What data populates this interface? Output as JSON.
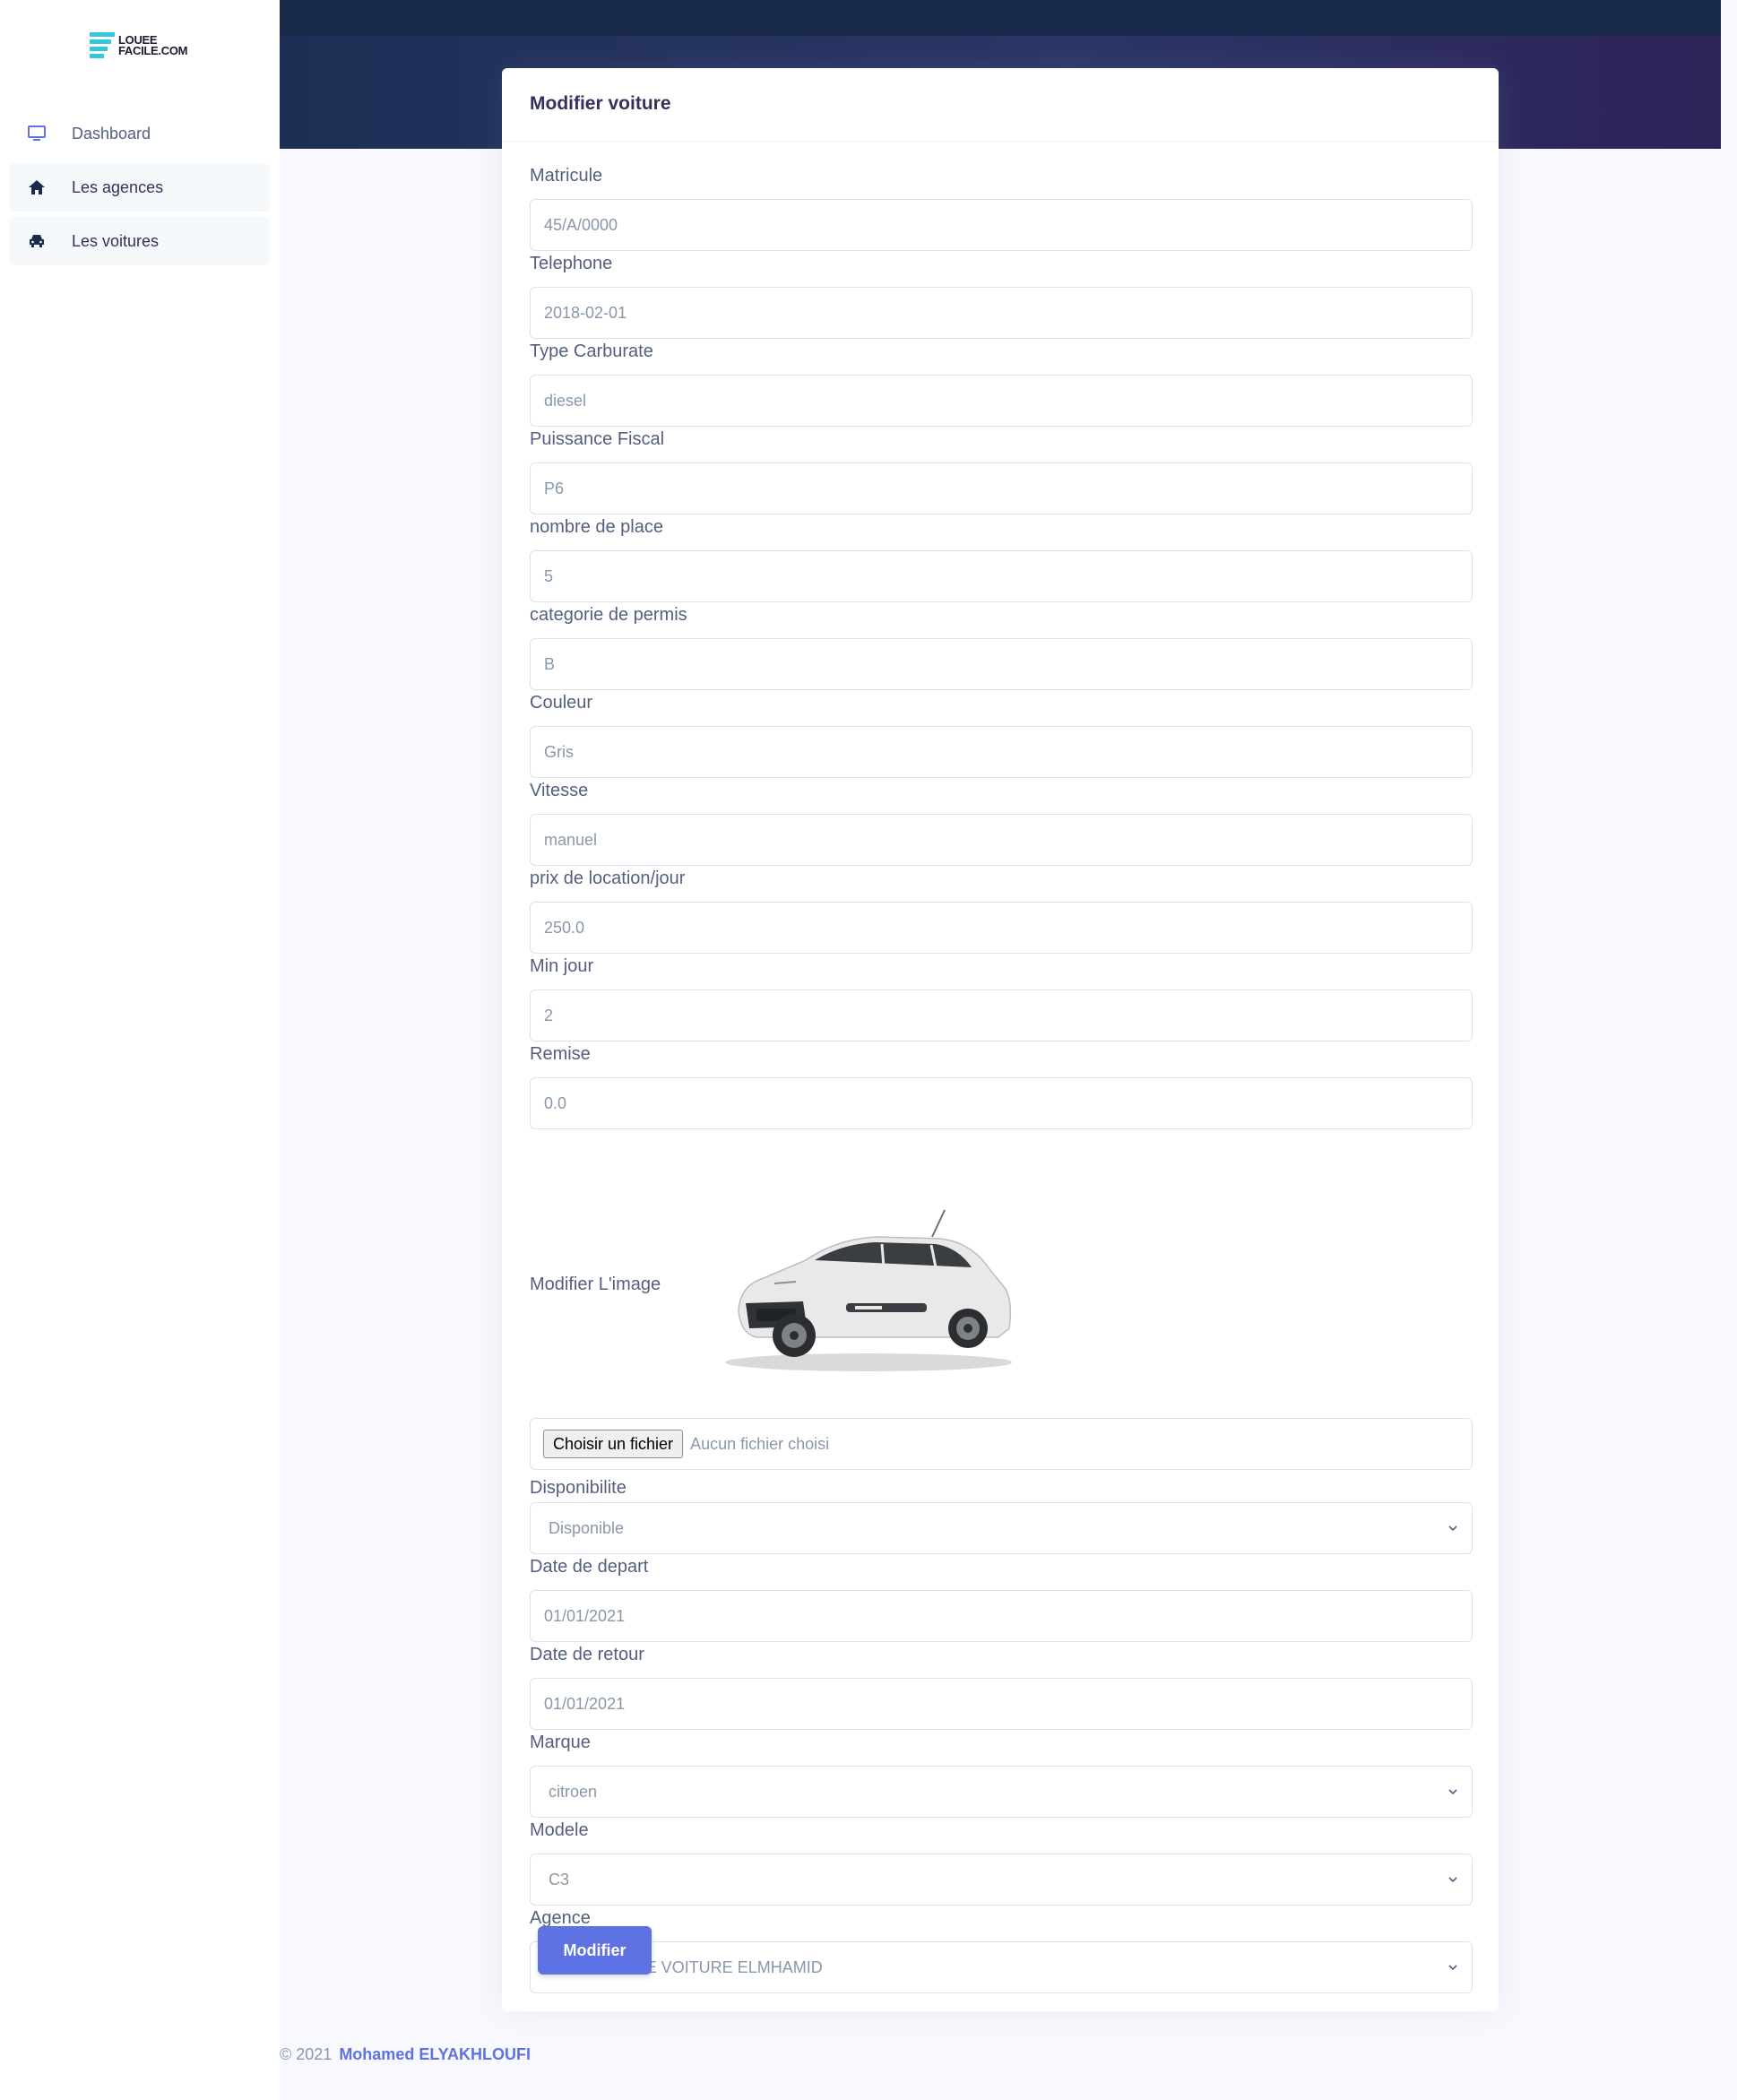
{
  "brand": {
    "line1": "LOUEE",
    "line2": "FACILE.COM",
    "accent": "#33c6e0"
  },
  "sidebar": {
    "items": [
      {
        "label": "Dashboard",
        "icon": "monitor-icon"
      },
      {
        "label": "Les agences",
        "icon": "home-icon"
      },
      {
        "label": "Les voitures",
        "icon": "car-icon"
      }
    ]
  },
  "card": {
    "title": "Modifier voiture"
  },
  "form": {
    "matricule": {
      "label": "Matricule",
      "value": "45/A/0000"
    },
    "telephone": {
      "label": "Telephone",
      "value": "2018-02-01"
    },
    "type_carburate": {
      "label": "Type Carburate",
      "value": "diesel"
    },
    "puissance_fiscal": {
      "label": "Puissance Fiscal",
      "value": "P6"
    },
    "nombre_place": {
      "label": "nombre de place",
      "value": "5"
    },
    "categorie_permis": {
      "label": "categorie de permis",
      "value": "B"
    },
    "couleur": {
      "label": "Couleur",
      "value": "Gris"
    },
    "vitesse": {
      "label": "Vitesse",
      "value": "manuel"
    },
    "prix_location": {
      "label": "prix de location/jour",
      "value": "250.0"
    },
    "min_jour": {
      "label": "Min jour",
      "value": "2"
    },
    "remise": {
      "label": "Remise",
      "value": "0.0"
    },
    "image": {
      "label": "Modifier L'image",
      "file_button": "Choisir un fichier",
      "file_status": "Aucun fichier choisi"
    },
    "disponibilite": {
      "label": "Disponibilite",
      "value": "Disponible"
    },
    "date_depart": {
      "label": "Date de depart",
      "value": "01/01/2021"
    },
    "date_retour": {
      "label": "Date de retour",
      "value": "01/01/2021"
    },
    "marque": {
      "label": "Marque",
      "value": "citroen"
    },
    "modele": {
      "label": "Modele",
      "value": "C3"
    },
    "agence": {
      "label": "Agence",
      "value": "LOCATION DE VOITURE ELMHAMID"
    },
    "submit_label": "Modifier"
  },
  "footer": {
    "copyright": "© 2021",
    "author": "Mohamed ELYAKHLOUFI"
  },
  "colors": {
    "primary": "#5e72e4",
    "header_dark": "#1a2a4b",
    "page_bg": "#f8f9fe"
  }
}
